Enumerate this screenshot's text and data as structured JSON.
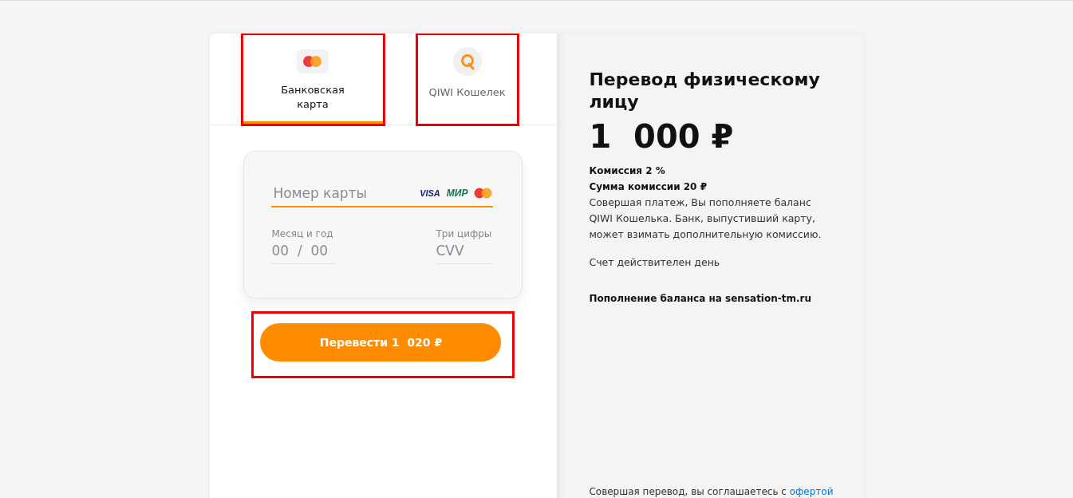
{
  "tabs": [
    {
      "label": "Банковская карта",
      "kind": "card",
      "selected": true,
      "highlighted": true
    },
    {
      "label": "QIWI Кошелек",
      "kind": "qiwi",
      "selected": false,
      "highlighted": true
    }
  ],
  "card_form": {
    "number_placeholder": "Номер карты",
    "brands": [
      "VISA",
      "МИР"
    ],
    "expiry_label": "Месяц и год",
    "expiry_placeholder": "00  /  00",
    "cvv_label": "Три цифры",
    "cvv_placeholder": "CVV"
  },
  "pay_button": {
    "label": "Перевести 1  020 ₽",
    "highlighted": true
  },
  "summary": {
    "title": "Перевод физическому лицу",
    "amount": "1  000 ₽",
    "commission": "Комиссия 2 %",
    "commission_sum": "Сумма комиссии 20 ₽",
    "note": "Совершая платеж, Вы пополняете баланс QIWI Кошелька. Банк, выпустивший карту, может взимать дополнительную комиссию.",
    "validity": "Счет действителен день",
    "merchant": "Пополнение баланса на sensation-tm.ru",
    "footer": "Совершая перевод, вы соглашаетесь с",
    "footer_link": "офертой"
  }
}
